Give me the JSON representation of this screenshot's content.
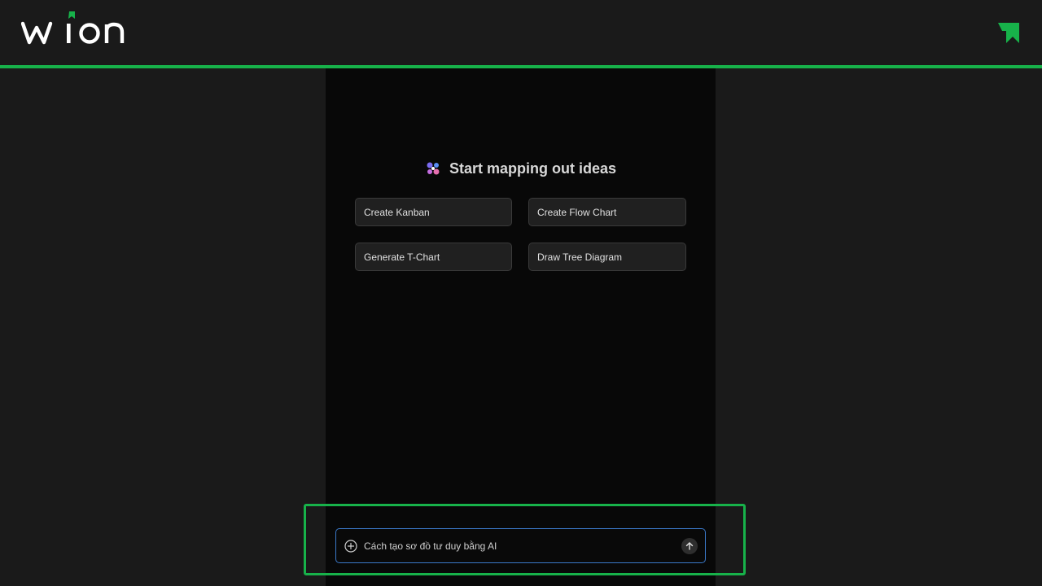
{
  "header": {
    "logo_text": "wion",
    "accent_color": "#17b24a"
  },
  "main": {
    "heading": "Start mapping out ideas",
    "options": [
      {
        "label": "Create Kanban"
      },
      {
        "label": "Create Flow Chart"
      },
      {
        "label": "Generate T-Chart"
      },
      {
        "label": "Draw Tree Diagram"
      }
    ]
  },
  "chat": {
    "placeholder": "Cách tạo sơ đồ tư duy bằng AI",
    "value": "",
    "add_icon": "plus-circle-icon",
    "send_icon": "arrow-up-icon"
  }
}
